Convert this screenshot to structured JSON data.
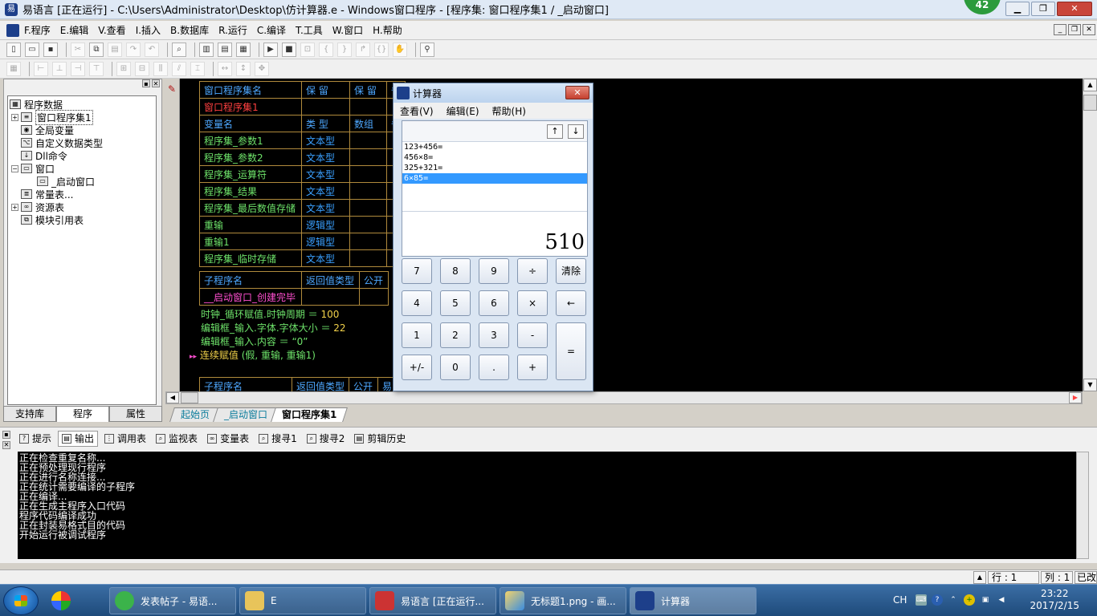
{
  "window": {
    "title": "易语言 [正在运行] - C:\\Users\\Administrator\\Desktop\\仿计算器.e - Windows窗口程序 - [程序集: 窗口程序集1 / _启动窗口]",
    "badge": "42",
    "min": "▁",
    "max": "❐",
    "close": "✕"
  },
  "menu": [
    "F.程序",
    "E.编辑",
    "V.查看",
    "I.插入",
    "B.数据库",
    "R.运行",
    "C.编译",
    "T.工具",
    "W.窗口",
    "H.帮助"
  ],
  "tree": {
    "root": "程序数据",
    "items": [
      "窗口程序集1",
      "全局变量",
      "自定义数据类型",
      "Dll命令",
      "窗口",
      "_启动窗口",
      "常量表...",
      "资源表",
      "模块引用表"
    ]
  },
  "left_tabs": [
    "支持库",
    "程序",
    "属性"
  ],
  "table1": {
    "header": [
      "窗口程序集名",
      "保 留",
      "保 留",
      "备"
    ],
    "name": "窗口程序集1",
    "var_header": [
      "变量名",
      "类 型",
      "数组",
      "备"
    ],
    "vars": [
      {
        "name": "程序集_参数1",
        "type": "文本型"
      },
      {
        "name": "程序集_参数2",
        "type": "文本型"
      },
      {
        "name": "程序集_运算符",
        "type": "文本型"
      },
      {
        "name": "程序集_结果",
        "type": "文本型"
      },
      {
        "name": "程序集_最后数值存储",
        "type": "文本型"
      },
      {
        "name": "重输",
        "type": "逻辑型"
      },
      {
        "name": "重输1",
        "type": "逻辑型"
      },
      {
        "name": "程序集_临时存储",
        "type": "文本型"
      }
    ]
  },
  "table2": {
    "header": [
      "子程序名",
      "返回值类型",
      "公开"
    ],
    "name": "__启动窗口_创建完毕"
  },
  "table3": {
    "header": [
      "子程序名",
      "返回值类型",
      "公开",
      "易"
    ]
  },
  "code": {
    "l1a": "时钟_循环赋值.时钟周期 ＝ ",
    "l1b": "100",
    "l2a": "编辑框_输入.字体.字体大小 ＝ ",
    "l2b": "22",
    "l3": "编辑框_输入.内容 ＝ “0”",
    "l4arrow": "▸▸",
    "l4a": "连续赋值 ",
    "l4b": "(假, 重输, 重输1)"
  },
  "doc_tabs": [
    "起始页",
    "_启动窗口",
    "窗口程序集1"
  ],
  "out_tabs": [
    "提示",
    "输出",
    "调用表",
    "监视表",
    "变量表",
    "搜寻1",
    "搜寻2",
    "剪辑历史"
  ],
  "output_lines": [
    "正在检查重复名称...",
    "正在预处理现行程序",
    "正在进行名称连接...",
    "正在统计需要编译的子程序",
    "正在编译...",
    "正在生成主程序入口代码",
    "程序代码编译成功",
    "正在封装易格式目的代码",
    "开始运行被调试程序"
  ],
  "status": {
    "row": "行 : 1",
    "col": "列 : 1",
    "mode": "已改"
  },
  "calc": {
    "title": "计算器",
    "menu": [
      "查看(V)",
      "编辑(E)",
      "帮助(H)"
    ],
    "history": [
      "123+456=",
      "456×8=",
      "325+321=",
      "6×85="
    ],
    "result": "510",
    "up": "↑",
    "down": "↓",
    "keys": [
      "7",
      "8",
      "9",
      "÷",
      "清除",
      "4",
      "5",
      "6",
      "×",
      "←",
      "1",
      "2",
      "3",
      "-",
      "=",
      "+/-",
      "0",
      ".",
      "+"
    ]
  },
  "taskbar": {
    "apps": [
      "发表帖子 - 易语...",
      "E",
      "易语言 [正在运行...",
      "无标题1.png - 画...",
      "计算器"
    ],
    "lang": "CH",
    "time": "23:22",
    "date": "2017/2/15"
  }
}
